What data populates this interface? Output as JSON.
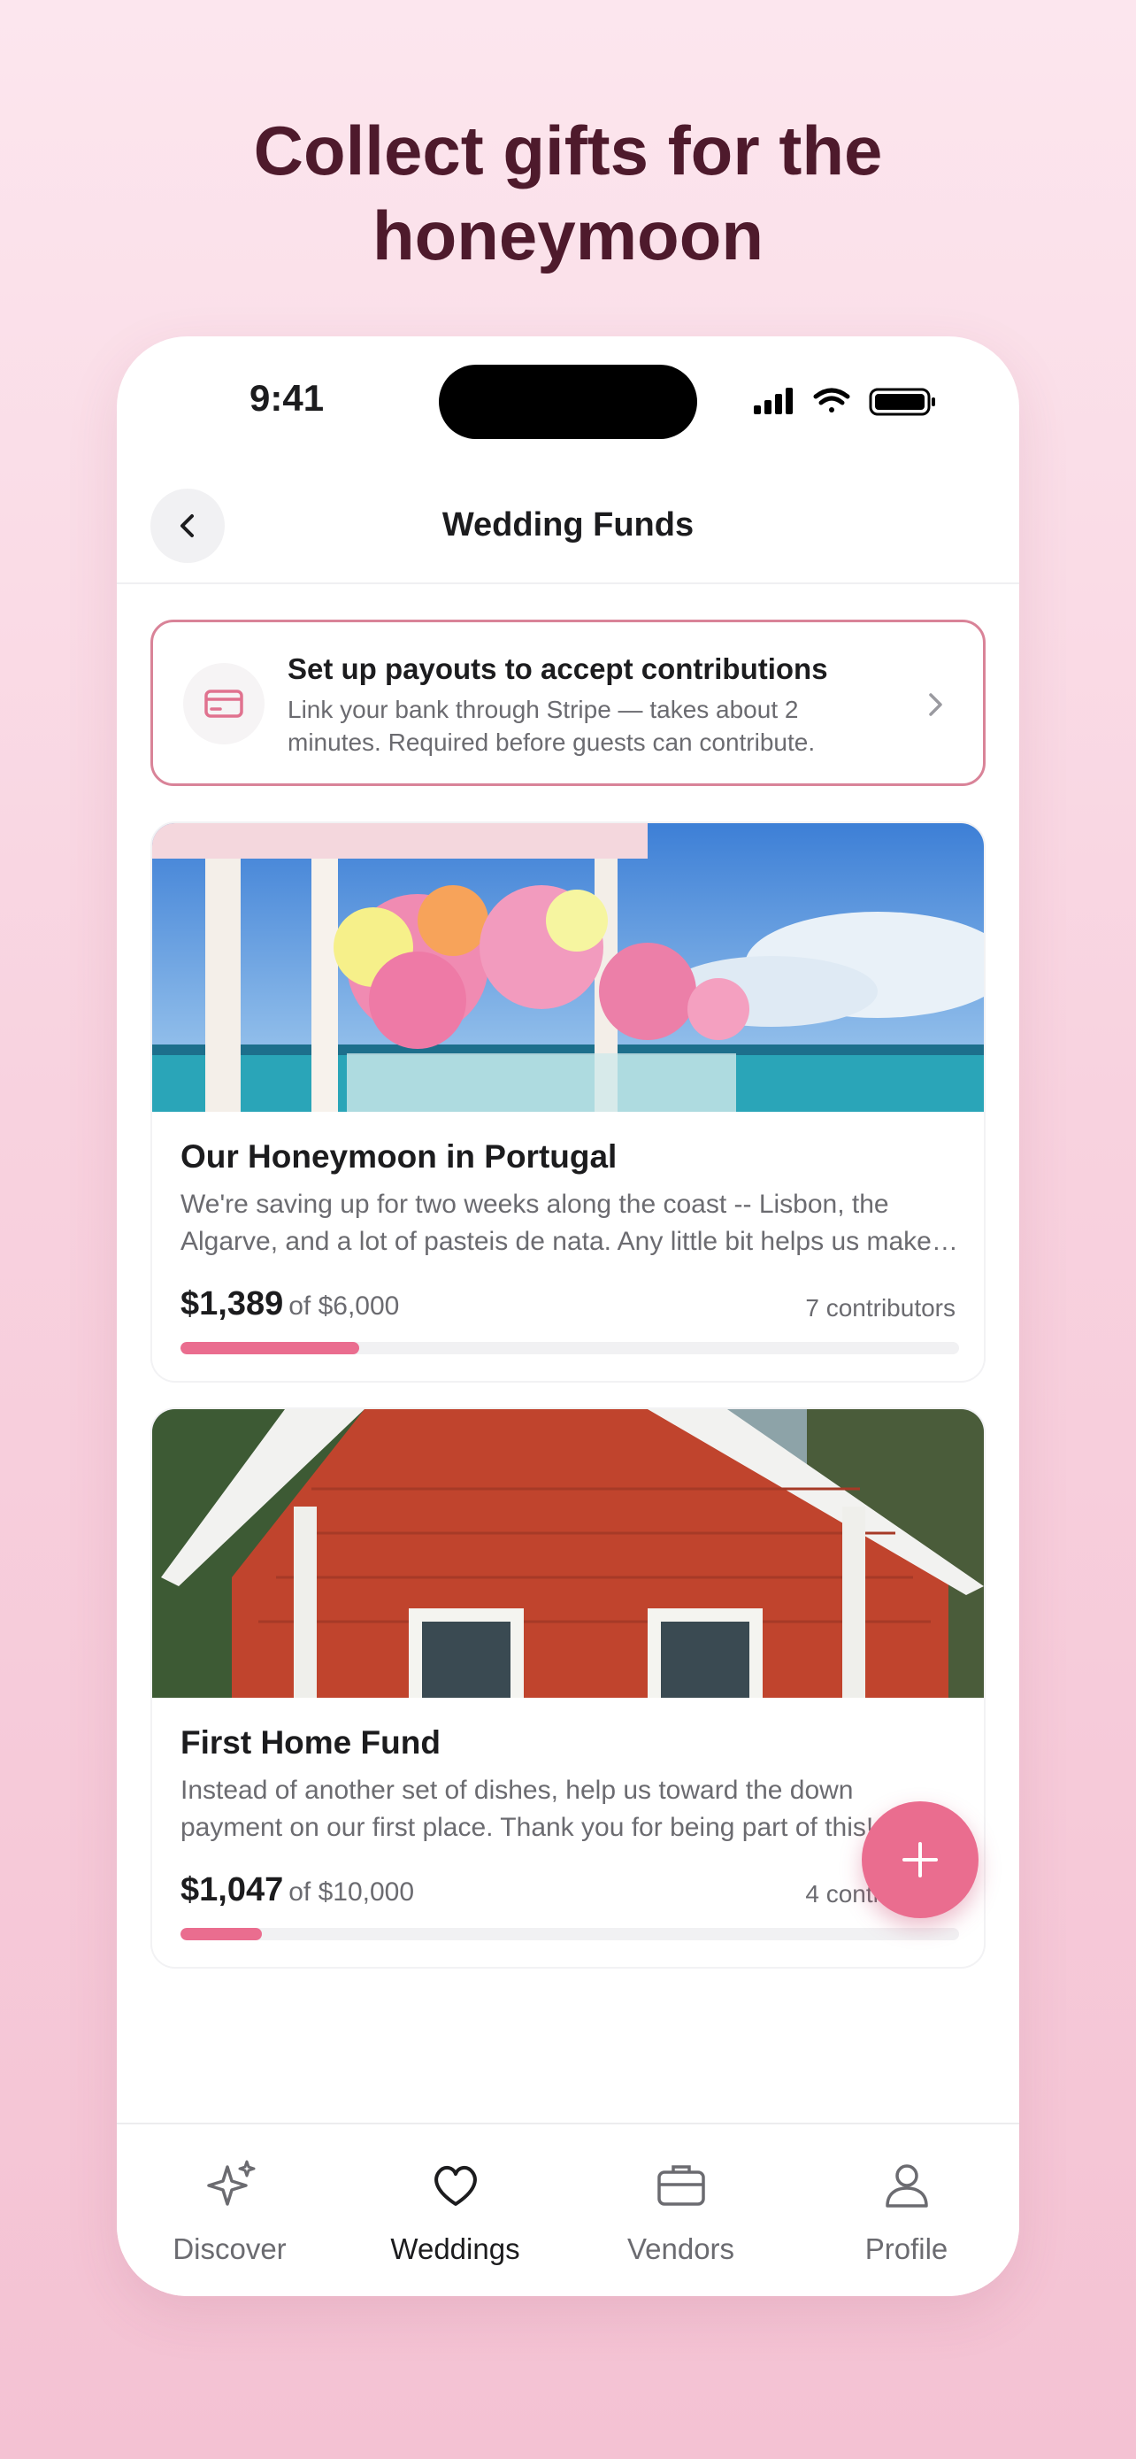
{
  "headline": "Collect gifts for the honeymoon",
  "status_bar": {
    "time": "9:41"
  },
  "header": {
    "title": "Wedding Funds",
    "back_icon": "chevron-left-icon"
  },
  "payout_banner": {
    "title": "Set up payouts to accept contributions",
    "subtitle": "Link your bank through Stripe — takes about 2 minutes. Required before guests can contribute.",
    "icon": "credit-card-icon"
  },
  "funds": [
    {
      "title": "Our Honeymoon in Portugal",
      "description": "We're saving up for two weeks along the coast -- Lisbon, the Algarve, and a lot of pasteis de nata. Any little bit helps us make it happen!",
      "raised": "$1,389",
      "goal": "of $6,000",
      "contributors": "7 contributors",
      "progress": 0.23,
      "image": "wedding-flowers-beach"
    },
    {
      "title": "First Home Fund",
      "description": "Instead of another set of dishes, help us toward the down payment on our first place. Thank you for being part of this!",
      "raised": "$1,047",
      "goal": "of $10,000",
      "contributors": "4 contributors",
      "progress": 0.105,
      "image": "red-house"
    }
  ],
  "fab": {
    "icon": "plus-icon"
  },
  "tabs": [
    {
      "label": "Discover",
      "icon": "sparkles-icon",
      "active": false
    },
    {
      "label": "Weddings",
      "icon": "heart-icon",
      "active": true
    },
    {
      "label": "Vendors",
      "icon": "briefcase-icon",
      "active": false
    },
    {
      "label": "Profile",
      "icon": "person-icon",
      "active": false
    }
  ],
  "colors": {
    "accent": "#ea6d8f",
    "headline": "#4e1a2c",
    "banner_border": "#d98398"
  }
}
